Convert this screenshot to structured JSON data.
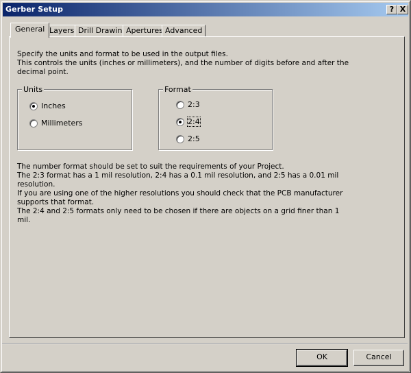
{
  "window": {
    "title": "Gerber Setup",
    "help_glyph": "?",
    "close_glyph": "X"
  },
  "tabs": [
    {
      "label": "General",
      "active": true
    },
    {
      "label": "Layers",
      "active": false
    },
    {
      "label": "Drill Drawing",
      "active": false
    },
    {
      "label": "Apertures",
      "active": false
    },
    {
      "label": "Advanced",
      "active": false
    }
  ],
  "intro": {
    "line1": "Specify the units and format to be used in the output files.",
    "line2": "This controls the units (inches or millimeters), and the number of digits before and after the",
    "line3": "decimal point."
  },
  "units": {
    "title": "Units",
    "options": [
      {
        "label": "Inches",
        "selected": true
      },
      {
        "label": "Millimeters",
        "selected": false
      }
    ]
  },
  "format": {
    "title": "Format",
    "options": [
      {
        "label": "2:3",
        "selected": false
      },
      {
        "label": "2:4",
        "selected": true
      },
      {
        "label": "2:5",
        "selected": false
      }
    ]
  },
  "notes": {
    "line1": "The number format should be set to suit the requirements of your Project.",
    "line2": "The 2:3 format has a 1 mil resolution, 2:4 has a 0.1 mil resolution, and 2:5 has a 0.01 mil",
    "line3": "resolution.",
    "line4": "If you are using one of the higher resolutions you should check that the PCB manufacturer",
    "line5": "supports that format.",
    "line6": "The 2:4 and 2:5 formats only need to be chosen if there are objects on a grid finer than 1",
    "line7": "mil."
  },
  "buttons": {
    "ok": "OK",
    "cancel": "Cancel"
  }
}
